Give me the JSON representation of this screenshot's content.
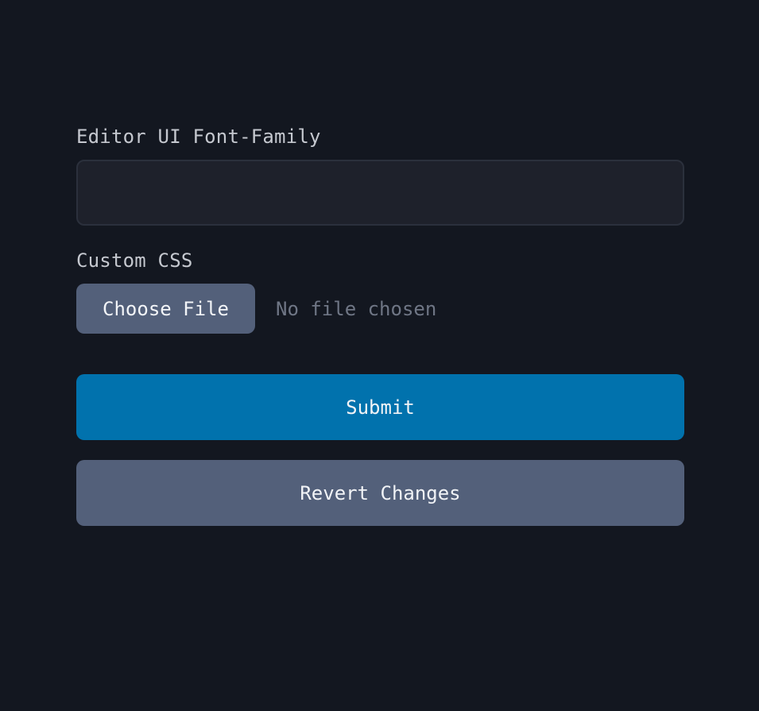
{
  "form": {
    "font_family_label": "Editor UI Font-Family",
    "font_family_value": "",
    "font_family_placeholder": "",
    "custom_css_label": "Custom CSS",
    "choose_file_label": "Choose File",
    "file_status": "No file chosen",
    "submit_label": "Submit",
    "revert_label": "Revert Changes"
  },
  "colors": {
    "background": "#131720",
    "input_background": "#1e212b",
    "primary": "#0172ad",
    "secondary": "#53607a",
    "muted_text": "#6f7685"
  }
}
